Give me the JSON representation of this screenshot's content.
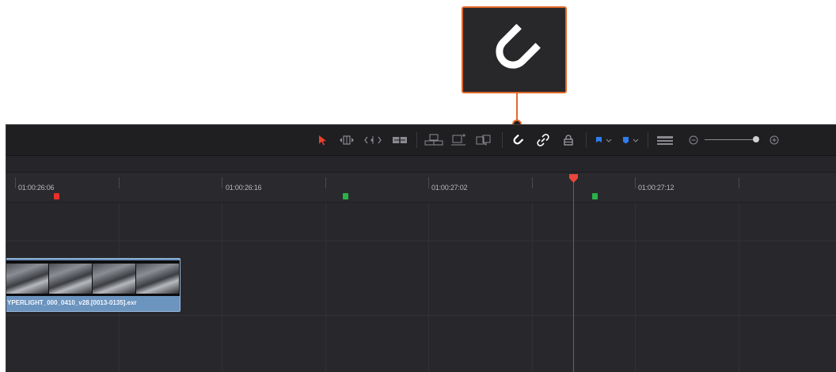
{
  "callout": {
    "icon": "snap-magnet-icon",
    "accent_color": "#e0682a"
  },
  "toolbar": {
    "tools": [
      {
        "name": "selection-mode",
        "icon": "pointer-arrow-icon",
        "active": true,
        "color": "#e8412c"
      },
      {
        "name": "trim-edit-mode",
        "icon": "trim-icon"
      },
      {
        "name": "dynamic-trim-mode",
        "icon": "dynamic-trim-icon"
      },
      {
        "name": "blade-edit-mode",
        "icon": "blade-icon"
      },
      {
        "name": "insert-clip",
        "icon": "insert-icon"
      },
      {
        "name": "overwrite-clip",
        "icon": "overwrite-icon"
      },
      {
        "name": "replace-clip",
        "icon": "replace-icon"
      },
      {
        "name": "snapping",
        "icon": "snap-magnet-icon",
        "active": true
      },
      {
        "name": "linked-selection",
        "icon": "link-icon"
      },
      {
        "name": "position-lock",
        "icon": "lock-icon"
      },
      {
        "name": "flag",
        "icon": "flag-icon",
        "color": "#2f7df0"
      },
      {
        "name": "marker",
        "icon": "marker-icon",
        "color": "#2f7df0"
      },
      {
        "name": "timeline-view-options",
        "icon": "view-options-icon"
      },
      {
        "name": "zoom-out",
        "icon": "zoom-out-icon"
      },
      {
        "name": "zoom-in",
        "icon": "zoom-in-icon"
      }
    ],
    "zoom_level": 0.95
  },
  "ruler": {
    "timecodes": [
      "01:00:26:06",
      "01:00:26:16",
      "01:00:27:02",
      "01:00:27:12"
    ],
    "markers": [
      {
        "color": "red"
      },
      {
        "color": "green"
      },
      {
        "color": "green"
      }
    ]
  },
  "clip": {
    "name": "YPERLIGHT_000_0410_v28.[0013-0135].exr",
    "color": "#6b94bf"
  },
  "playhead": {
    "color": "#c13a2c"
  }
}
